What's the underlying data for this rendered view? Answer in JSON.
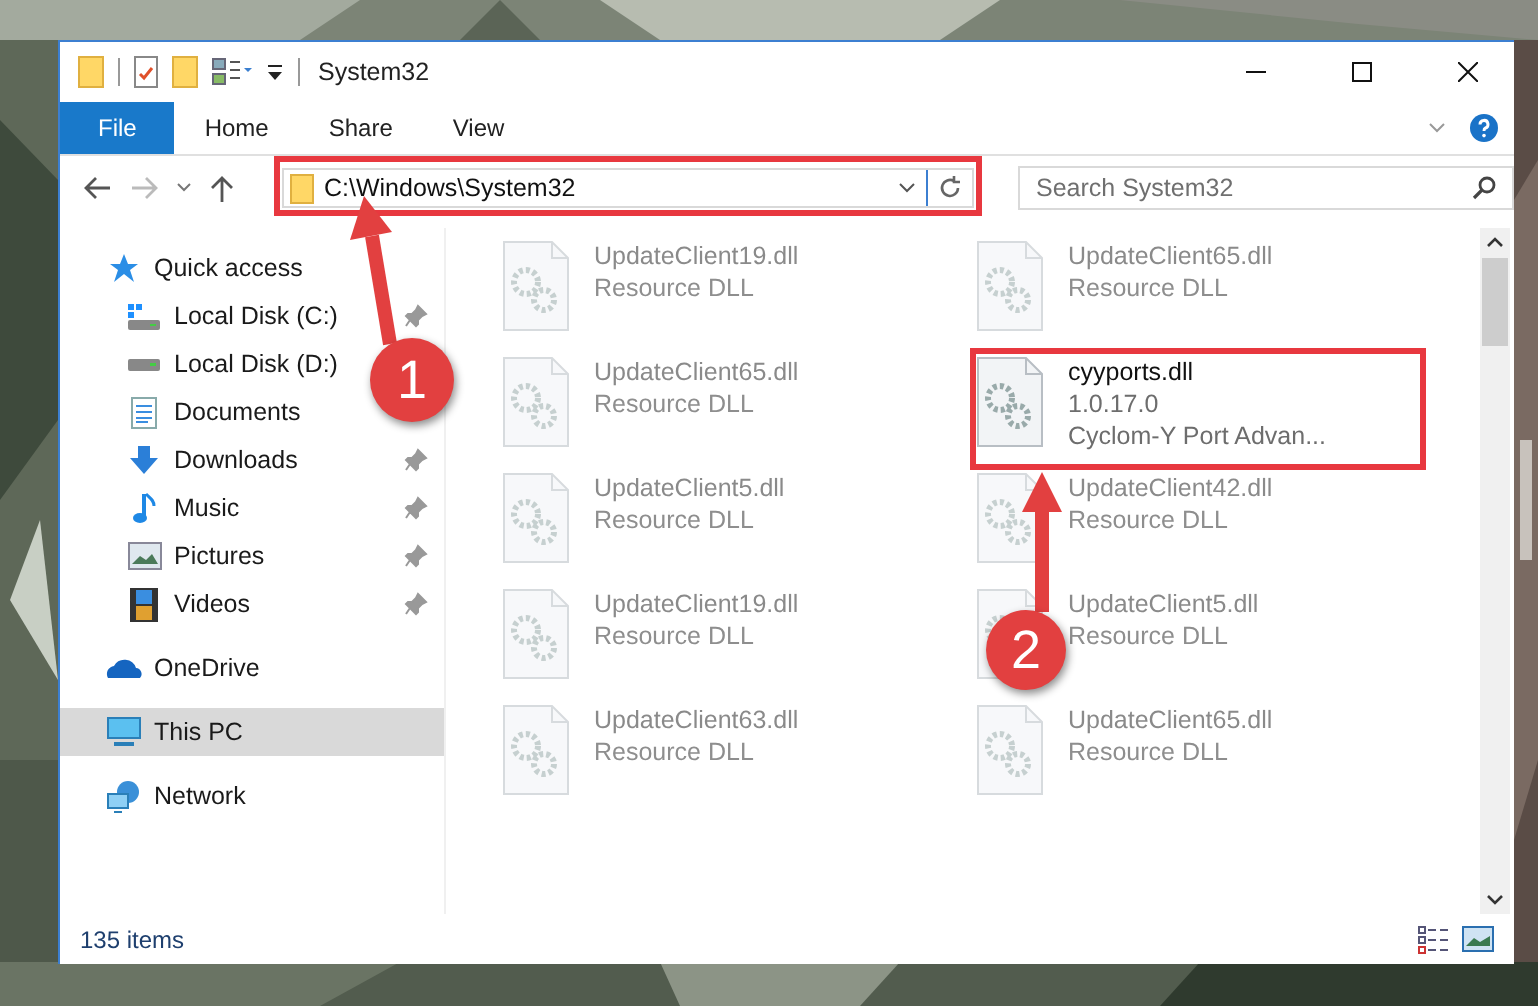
{
  "window": {
    "title": "System32"
  },
  "ribbon": {
    "tabs": [
      {
        "label": "File",
        "kind": "menu",
        "selected": false
      },
      {
        "label": "Home",
        "kind": "tab",
        "selected": false
      },
      {
        "label": "Share",
        "kind": "tab",
        "selected": false
      },
      {
        "label": "View",
        "kind": "tab",
        "selected": false
      }
    ]
  },
  "address_bar": {
    "path": "C:\\Windows\\System32"
  },
  "search": {
    "placeholder": "Search System32"
  },
  "sidebar": {
    "items": [
      {
        "label": "Quick access",
        "kind": "quick-access",
        "selected": false,
        "children": [
          {
            "label": "Local Disk (C:)",
            "kind": "drive-system",
            "selected": false,
            "pinned": true
          },
          {
            "label": "Local Disk (D:)",
            "kind": "drive",
            "selected": false,
            "pinned": false
          },
          {
            "label": "Documents",
            "kind": "documents",
            "selected": false,
            "pinned": false
          },
          {
            "label": "Downloads",
            "kind": "downloads",
            "selected": false,
            "pinned": true
          },
          {
            "label": "Music",
            "kind": "music",
            "selected": false,
            "pinned": true
          },
          {
            "label": "Pictures",
            "kind": "pictures",
            "selected": false,
            "pinned": true
          },
          {
            "label": "Videos",
            "kind": "videos",
            "selected": false,
            "pinned": true
          }
        ]
      },
      {
        "label": "OneDrive",
        "kind": "onedrive",
        "selected": false
      },
      {
        "label": "This PC",
        "kind": "pc",
        "selected": true
      },
      {
        "label": "Network",
        "kind": "network",
        "selected": false
      }
    ]
  },
  "files": [
    {
      "name": "UpdateClient19.dll",
      "details": [
        "Resource DLL"
      ],
      "blurred": true
    },
    {
      "name": "UpdateClient65.dll",
      "details": [
        "Resource DLL"
      ],
      "blurred": true
    },
    {
      "name": "UpdateClient65.dll",
      "details": [
        "Resource DLL"
      ],
      "blurred": true
    },
    {
      "name": "cyyports.dll",
      "details": [
        "1.0.17.0",
        "Cyclom-Y Port Advan..."
      ],
      "blurred": false
    },
    {
      "name": "UpdateClient5.dll",
      "details": [
        "Resource DLL"
      ],
      "blurred": true
    },
    {
      "name": "UpdateClient42.dll",
      "details": [
        "Resource DLL"
      ],
      "blurred": true
    },
    {
      "name": "UpdateClient19.dll",
      "details": [
        "Resource DLL"
      ],
      "blurred": true
    },
    {
      "name": "UpdateClient5.dll",
      "details": [
        "Resource DLL"
      ],
      "blurred": true
    },
    {
      "name": "UpdateClient63.dll",
      "details": [
        "Resource DLL"
      ],
      "blurred": true
    },
    {
      "name": "UpdateClient65.dll",
      "details": [
        "Resource DLL"
      ],
      "blurred": true
    }
  ],
  "status_bar": {
    "item_count": "135 items"
  },
  "callouts": [
    {
      "label": "1"
    },
    {
      "label": "2"
    }
  ]
}
